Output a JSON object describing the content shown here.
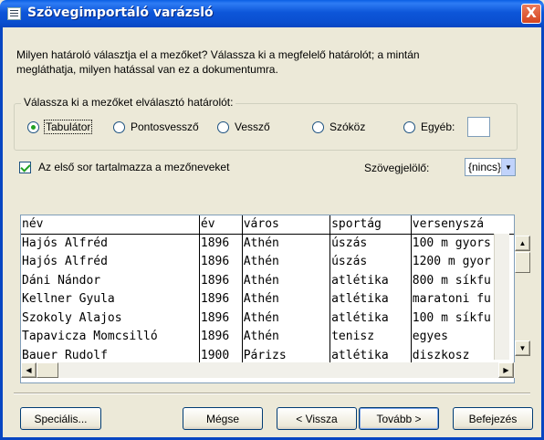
{
  "window": {
    "title": "Szövegimportáló varázsló",
    "close_label": "X"
  },
  "intro": {
    "line1": "Milyen határoló választja el a mezőket? Válassza ki a megfelelő határolót; a mintán",
    "line2": "megláthatja, milyen hatással van ez a dokumentumra."
  },
  "delimiter_group": {
    "legend": "Válassza ki a mezőket elválasztó határolót:",
    "options": [
      {
        "label": "Tabulátor",
        "selected": true
      },
      {
        "label": "Pontosvessző",
        "selected": false
      },
      {
        "label": "Vessző",
        "selected": false
      },
      {
        "label": "Szóköz",
        "selected": false
      },
      {
        "label": "Egyéb:",
        "selected": false
      }
    ],
    "other_value": ""
  },
  "first_row": {
    "label": "Az első sor tartalmazza a mezőneveket",
    "checked": true
  },
  "text_qualifier": {
    "label": "Szövegjelölő:",
    "value": "{nincs}"
  },
  "preview": {
    "headers": [
      "név",
      "év",
      "város",
      "sportág",
      "versenyszá"
    ],
    "rows": [
      [
        "Hajós Alfréd",
        "1896",
        "Athén",
        "úszás",
        "100 m gyors"
      ],
      [
        "Hajós Alfréd",
        "1896",
        "Athén",
        "úszás",
        "1200 m gyor"
      ],
      [
        "Dáni Nándor",
        "1896",
        "Athén",
        "atlétika",
        "800 m síkfu"
      ],
      [
        "Kellner Gyula",
        "1896",
        "Athén",
        "atlétika",
        "maratoni fu"
      ],
      [
        "Szokoly Alajos",
        "1896",
        "Athén",
        "atlétika",
        "100 m síkfu"
      ],
      [
        "Tapavicza Momcsilló",
        "1896",
        "Athén",
        "tenisz",
        "egyes"
      ],
      [
        "Bauer Rudolf",
        "1900",
        "Párizs",
        "atlétika",
        "diszkosz"
      ]
    ]
  },
  "buttons": {
    "advanced": "Speciális...",
    "cancel": "Mégse",
    "back": "< Vissza",
    "next": "Tovább >",
    "finish": "Befejezés"
  },
  "icons": {
    "scroll_up": "▲",
    "scroll_down": "▼",
    "scroll_left": "◀",
    "scroll_right": "▶",
    "dropdown": "▼"
  }
}
